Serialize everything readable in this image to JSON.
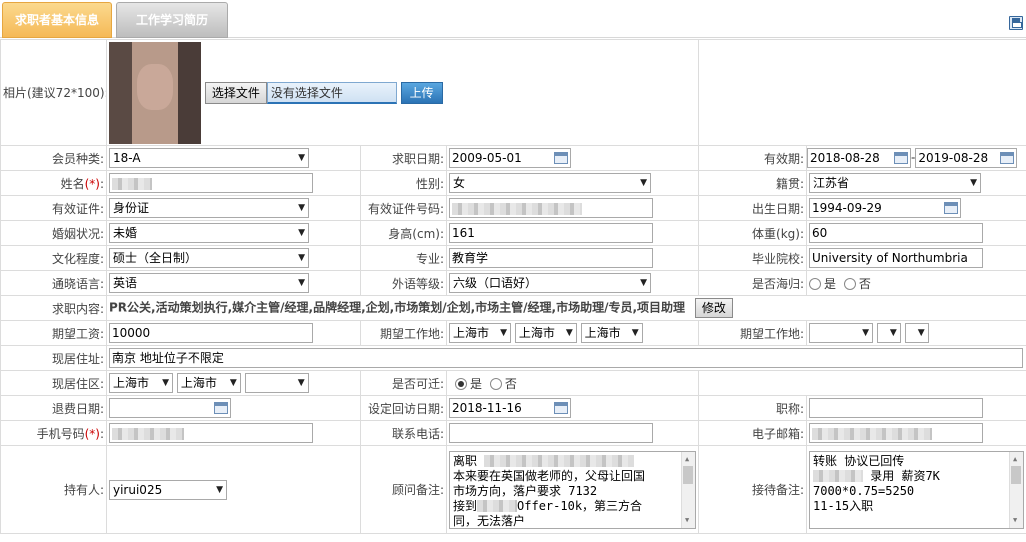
{
  "tabs": [
    {
      "label": "求职者基本信息",
      "active": true
    },
    {
      "label": "工作学习简历",
      "active": false
    }
  ],
  "icons": {
    "save": "save-icon",
    "calendar": "calendar-icon",
    "dropdown": "chevron-down-icon"
  },
  "photo": {
    "label": "相片(建议72*100):",
    "choose_button": "选择文件",
    "file_status": "没有选择文件",
    "upload_button": "上传"
  },
  "form": {
    "member_type": {
      "label": "会员种类:",
      "value": "18-A"
    },
    "apply_date": {
      "label": "求职日期:",
      "value": "2009-05-01"
    },
    "valid_period": {
      "label": "有效期:",
      "start": "2018-08-28",
      "sep": "-",
      "end": "2019-08-28"
    },
    "name": {
      "label": "姓名",
      "required": "(*)",
      "colon": ":"
    },
    "gender": {
      "label": "性别:",
      "value": "女"
    },
    "native": {
      "label": "籍贯:",
      "value": "江苏省"
    },
    "id_type": {
      "label": "有效证件:",
      "value": "身份证"
    },
    "id_number": {
      "label": "有效证件号码:"
    },
    "birth_date": {
      "label": "出生日期:",
      "value": "1994-09-29"
    },
    "marital": {
      "label": "婚姻状况:",
      "value": "未婚"
    },
    "height": {
      "label": "身高(cm):",
      "value": "161"
    },
    "weight": {
      "label": "体重(kg):",
      "value": "60"
    },
    "education": {
      "label": "文化程度:",
      "value": "硕士（全日制）"
    },
    "major": {
      "label": "专业:",
      "value": "教育学"
    },
    "school": {
      "label": "毕业院校:",
      "value": "University of Northumbria"
    },
    "language": {
      "label": "通晓语言:",
      "value": "英语"
    },
    "language_level": {
      "label": "外语等级:",
      "value": "六级（口语好）"
    },
    "returnee": {
      "label": "是否海归:",
      "yes": "是",
      "no": "否"
    },
    "job_content": {
      "label": "求职内容:",
      "value": "PR公关,活动策划执行,媒介主管/经理,品牌经理,企划,市场策划/企划,市场主管/经理,市场助理/专员,项目助理",
      "edit_button": "修改"
    },
    "expected_salary": {
      "label": "期望工资:",
      "value": "10000"
    },
    "expected_location1": {
      "label": "期望工作地:",
      "v1": "上海市",
      "v2": "上海市",
      "v3": "上海市"
    },
    "expected_location2": {
      "label": "期望工作地:"
    },
    "current_address": {
      "label": "现居住址:",
      "value": "南京 地址位子不限定"
    },
    "current_area": {
      "label": "现居住区:",
      "v1": "上海市",
      "v2": "上海市"
    },
    "relocate": {
      "label": "是否可迁:",
      "yes": "是",
      "no": "否"
    },
    "refund_date": {
      "label": "退费日期:"
    },
    "callback_date": {
      "label": "设定回访日期:",
      "value": "2018-11-16"
    },
    "job_title": {
      "label": "职称:"
    },
    "mobile": {
      "label": "手机号码",
      "required": "(*)",
      "colon": ":"
    },
    "phone": {
      "label": "联系电话:"
    },
    "email": {
      "label": "电子邮箱:"
    },
    "holder": {
      "label": "持有人:",
      "value": "yirui025"
    },
    "consultant_note": {
      "label": "顾问备注:",
      "lines": [
        "离职",
        "本来要在英国做老师的，父母让回国",
        "市场方向，落户要求  7132",
        "接到",
        "Offer-10k，第三方合",
        "同，无法落户"
      ]
    },
    "reception_note": {
      "label": "接待备注:",
      "lines": [
        "转账 协议已回传",
        "录用  薪资7K",
        "7000*0.75=5250",
        "11-15入职"
      ]
    }
  }
}
